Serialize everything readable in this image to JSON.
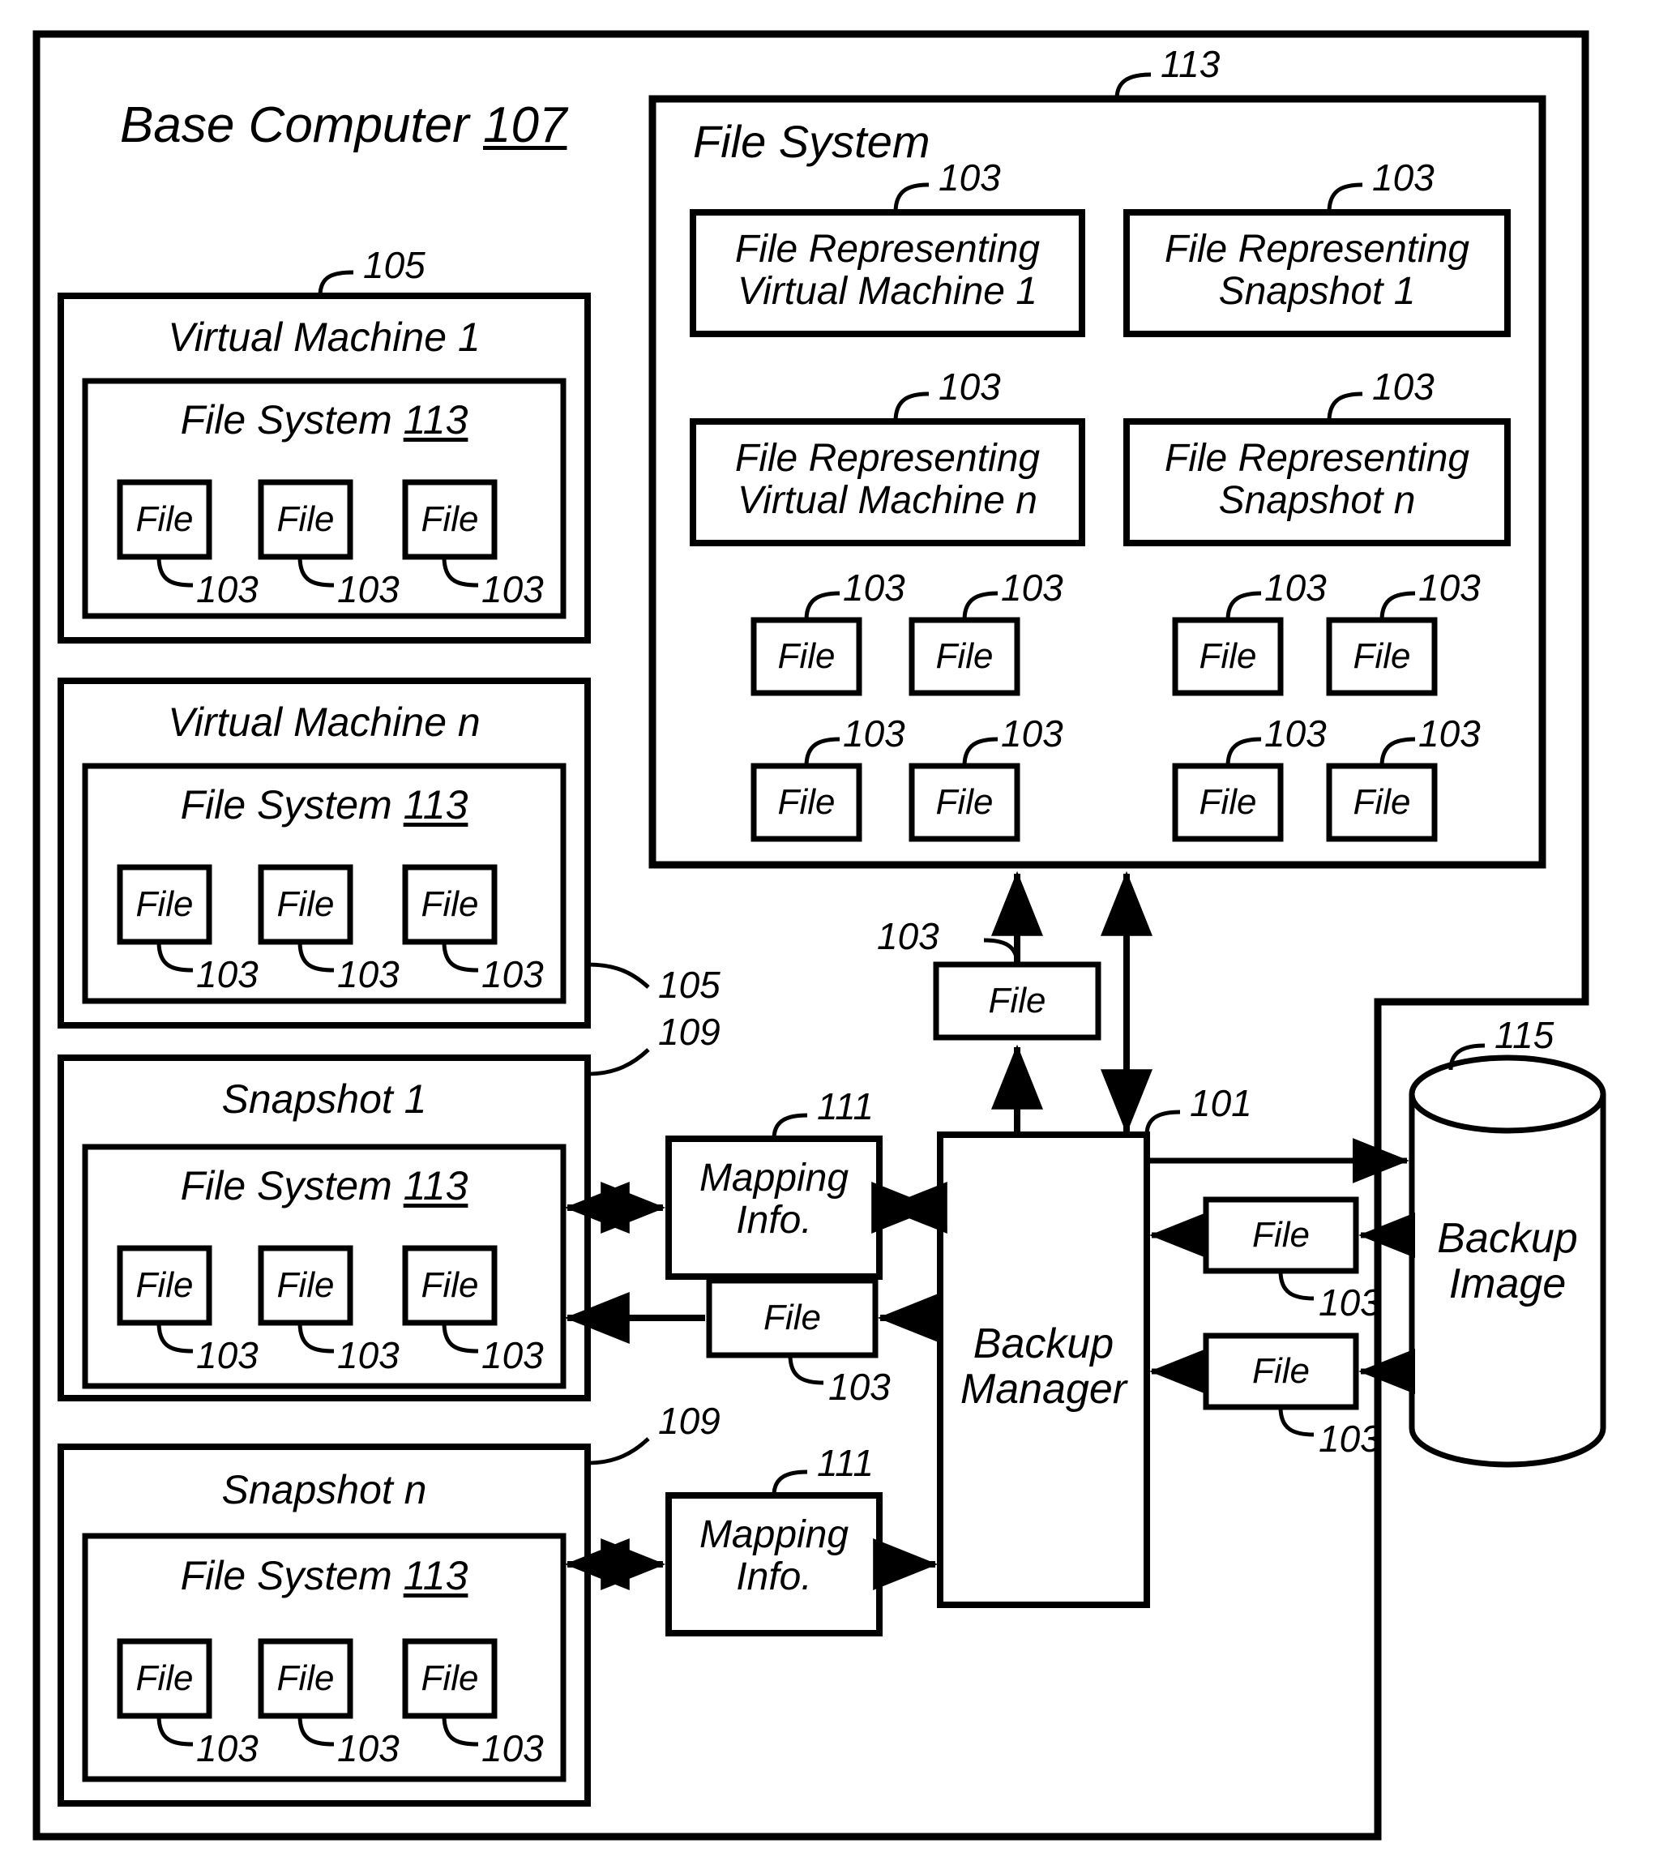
{
  "figure": {
    "type": "patent-block-diagram",
    "base_computer": {
      "title": "Base Computer",
      "ref": "107",
      "ref_outer": "113"
    },
    "virtual_machines": [
      {
        "title": "Virtual Machine 1",
        "ref": "105",
        "filesystem": {
          "title": "File System",
          "ref": "113"
        },
        "files": [
          {
            "label": "File",
            "ref": "103"
          },
          {
            "label": "File",
            "ref": "103"
          },
          {
            "label": "File",
            "ref": "103"
          }
        ]
      },
      {
        "title": "Virtual Machine n",
        "ref": "105",
        "filesystem": {
          "title": "File System",
          "ref": "113"
        },
        "files": [
          {
            "label": "File",
            "ref": "103"
          },
          {
            "label": "File",
            "ref": "103"
          },
          {
            "label": "File",
            "ref": "103"
          }
        ]
      }
    ],
    "snapshots": [
      {
        "title": "Snapshot 1",
        "ref": "109",
        "filesystem": {
          "title": "File System",
          "ref": "113"
        },
        "files": [
          {
            "label": "File",
            "ref": "103"
          },
          {
            "label": "File",
            "ref": "103"
          },
          {
            "label": "File",
            "ref": "103"
          }
        ],
        "mapping_info": {
          "line1": "Mapping",
          "line2": "Info.",
          "ref": "111"
        },
        "restore_file": {
          "label": "File",
          "ref": "103"
        }
      },
      {
        "title": "Snapshot n",
        "ref": "109",
        "filesystem": {
          "title": "File System",
          "ref": "113"
        },
        "files": [
          {
            "label": "File",
            "ref": "103"
          },
          {
            "label": "File",
            "ref": "103"
          },
          {
            "label": "File",
            "ref": "103"
          }
        ],
        "mapping_info": {
          "line1": "Mapping",
          "line2": "Info.",
          "ref": "111"
        }
      }
    ],
    "host_file_system": {
      "title": "File System",
      "ref": "113",
      "representing_files": [
        {
          "line1": "File Representing",
          "line2": "Virtual Machine 1",
          "ref": "103"
        },
        {
          "line1": "File Representing",
          "line2": "Snapshot 1",
          "ref": "103"
        },
        {
          "line1": "File Representing",
          "line2": "Virtual Machine n",
          "ref": "103"
        },
        {
          "line1": "File Representing",
          "line2": "Snapshot n",
          "ref": "103"
        }
      ],
      "loose_files": [
        {
          "label": "File",
          "ref": "103"
        },
        {
          "label": "File",
          "ref": "103"
        },
        {
          "label": "File",
          "ref": "103"
        },
        {
          "label": "File",
          "ref": "103"
        },
        {
          "label": "File",
          "ref": "103"
        },
        {
          "label": "File",
          "ref": "103"
        },
        {
          "label": "File",
          "ref": "103"
        },
        {
          "label": "File",
          "ref": "103"
        }
      ]
    },
    "backup_manager": {
      "line1": "Backup",
      "line2": "Manager",
      "ref": "101"
    },
    "backup_image": {
      "line1": "Backup",
      "line2": "Image",
      "ref": "115"
    },
    "transit_files": [
      {
        "label": "File",
        "ref": "103",
        "role": "to-file-system"
      },
      {
        "label": "File",
        "ref": "103",
        "role": "from-backup-image-upper"
      },
      {
        "label": "File",
        "ref": "103",
        "role": "from-backup-image-lower"
      }
    ]
  }
}
